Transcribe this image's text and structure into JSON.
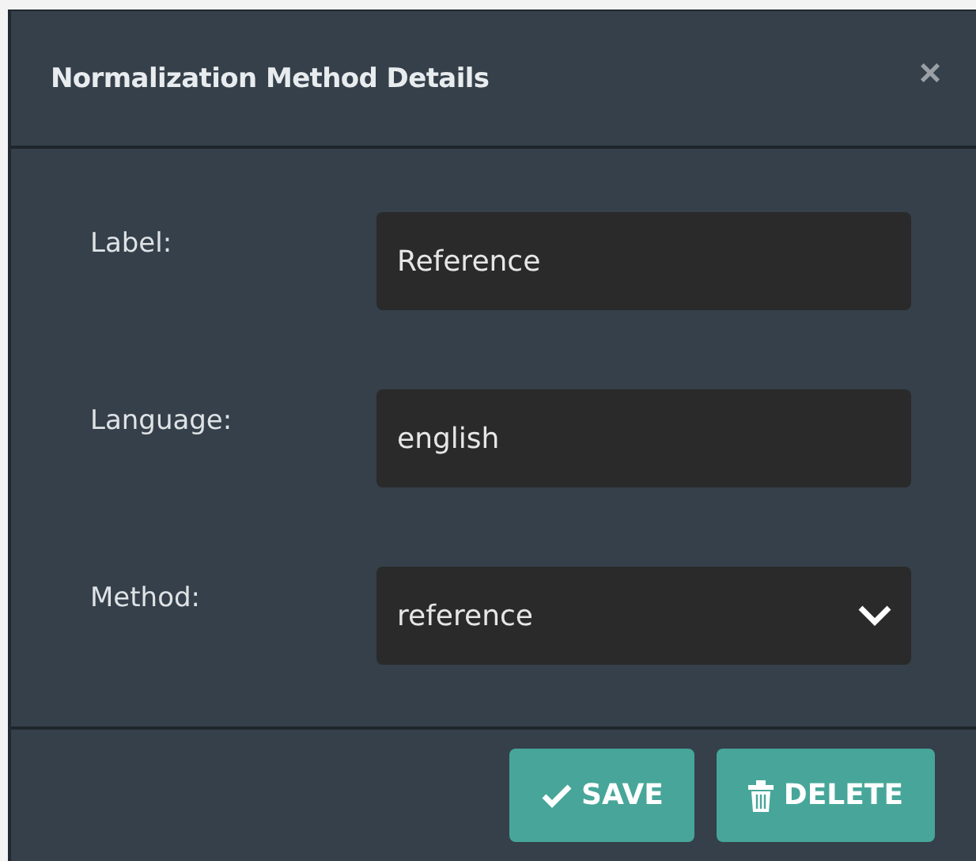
{
  "dialog": {
    "title": "Normalization Method Details",
    "close": "×"
  },
  "fields": [
    {
      "kind": "text",
      "label": "Label:",
      "value": "Reference"
    },
    {
      "kind": "text",
      "label": "Language:",
      "value": "english"
    },
    {
      "kind": "select",
      "label": "Method:",
      "value": "reference"
    }
  ],
  "buttons": [
    {
      "kind": "save",
      "label": "SAVE"
    },
    {
      "kind": "delete",
      "label": "DELETE"
    }
  ]
}
